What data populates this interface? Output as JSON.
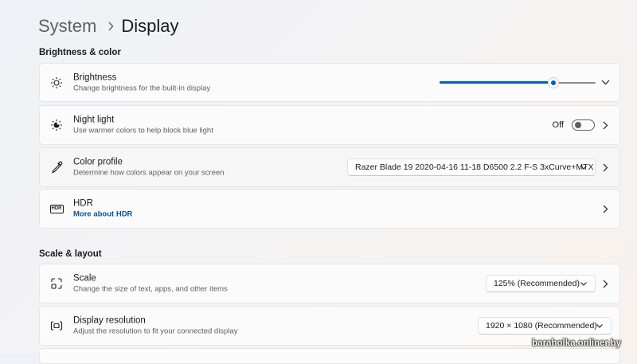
{
  "breadcrumb": {
    "parent": "System",
    "current": "Display"
  },
  "sections": {
    "brightness_color": "Brightness & color",
    "scale_layout": "Scale & layout"
  },
  "brightness": {
    "title": "Brightness",
    "subtitle": "Change brightness for the built-in display",
    "level_fraction": 0.73
  },
  "night_light": {
    "title": "Night light",
    "subtitle": "Use warmer colors to help block blue light",
    "state_label": "Off"
  },
  "color_profile": {
    "title": "Color profile",
    "subtitle": "Determine how colors appear on your screen",
    "selected": "Razer Blade 19 2020-04-16 11-18 D6500 2.2 F-S 3xCurve+MTX"
  },
  "hdr": {
    "title": "HDR",
    "link": "More about HDR",
    "icon_text": "HDR"
  },
  "scale": {
    "title": "Scale",
    "subtitle": "Change the size of text, apps, and other items",
    "selected": "125% (Recommended)"
  },
  "resolution": {
    "title": "Display resolution",
    "subtitle": "Adjust the resolution to fit your connected display",
    "selected": "1920 × 1080 (Recommended)"
  },
  "watermark": "baraholka.onliner.by",
  "colors": {
    "accent": "#005fb8",
    "link": "#0e4fa0"
  },
  "icons": {
    "brightness": "sun-icon",
    "night_light": "sun-moon-icon",
    "color_profile": "eyedropper-icon",
    "hdr": "hdr-icon",
    "scale": "scale-icon",
    "resolution": "resolution-icon"
  }
}
